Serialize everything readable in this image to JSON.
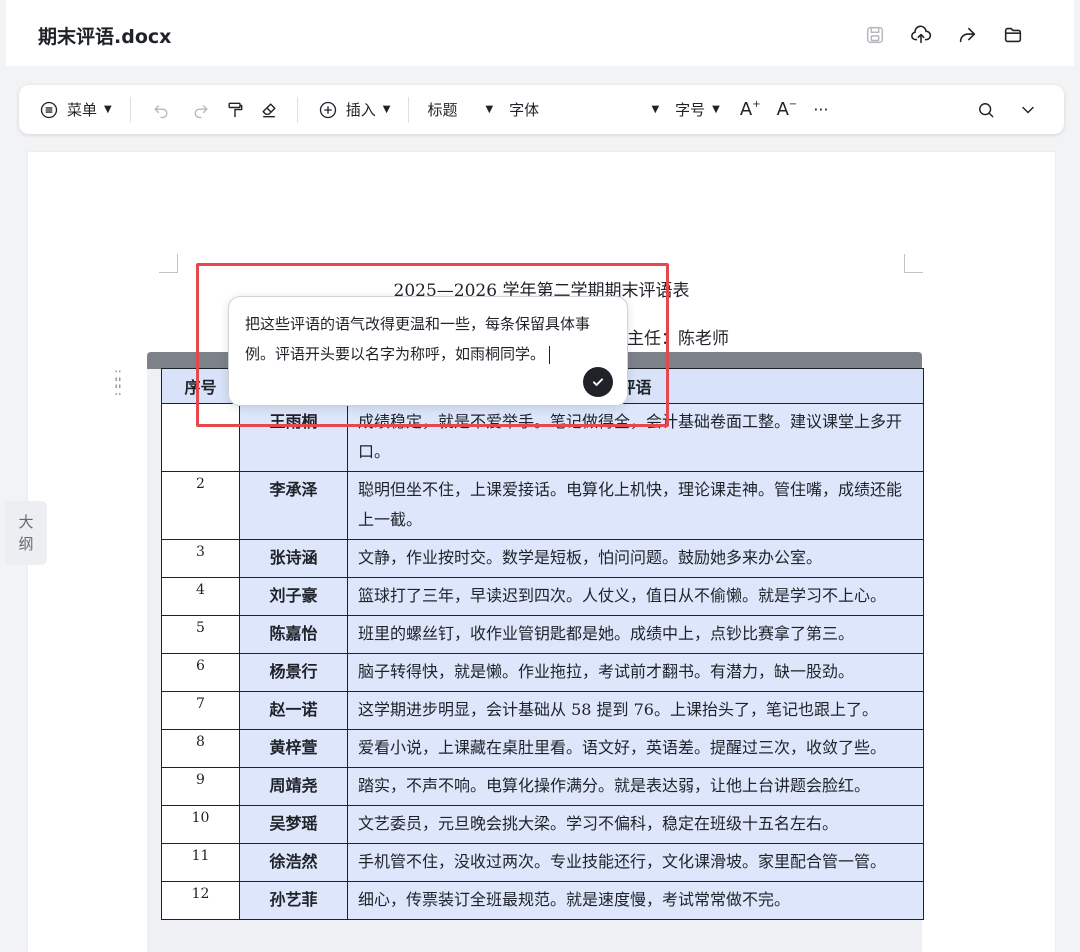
{
  "header": {
    "doc_title": "期末评语.docx",
    "icons": [
      "save-icon",
      "cloud-upload-icon",
      "share-icon",
      "folder-icon"
    ]
  },
  "toolbar": {
    "menu_label": "菜单",
    "insert_label": "插入",
    "heading_label": "标题",
    "font_label": "字体",
    "font_size_label": "字号",
    "increase_font": "A",
    "decrease_font": "A",
    "more": "···"
  },
  "sidebar": {
    "outline_label_1": "大",
    "outline_label_2": "纲"
  },
  "document": {
    "title": "2025—2026 学年第二学期期末评语表",
    "teacher_line": "主任：陈老师",
    "table": {
      "headers": [
        "序号",
        "",
        "评语"
      ],
      "rows": [
        {
          "no": "",
          "name": "王雨桐",
          "comment": "成绩稳定，就是不爱举手。笔记做得全，会计基础卷面工整。建议课堂上多开口。"
        },
        {
          "no": "2",
          "name": "李承泽",
          "comment": "聪明但坐不住，上课爱接话。电算化上机快，理论课走神。管住嘴，成绩还能上一截。"
        },
        {
          "no": "3",
          "name": "张诗涵",
          "comment": "文静，作业按时交。数学是短板，怕问问题。鼓励她多来办公室。"
        },
        {
          "no": "4",
          "name": "刘子豪",
          "comment": "篮球打了三年，早读迟到四次。人仗义，值日从不偷懒。就是学习不上心。"
        },
        {
          "no": "5",
          "name": "陈嘉怡",
          "comment": "班里的螺丝钉，收作业管钥匙都是她。成绩中上，点钞比赛拿了第三。"
        },
        {
          "no": "6",
          "name": "杨景行",
          "comment": "脑子转得快，就是懒。作业拖拉，考试前才翻书。有潜力，缺一股劲。"
        },
        {
          "no": "7",
          "name": "赵一诺",
          "comment": "这学期进步明显，会计基础从 58 提到 76。上课抬头了，笔记也跟上了。"
        },
        {
          "no": "8",
          "name": "黄梓萱",
          "comment": "爱看小说，上课藏在桌肚里看。语文好，英语差。提醒过三次，收敛了些。"
        },
        {
          "no": "9",
          "name": "周靖尧",
          "comment": "踏实，不声不响。电算化操作满分。就是表达弱，让他上台讲题会脸红。"
        },
        {
          "no": "10",
          "name": "吴梦瑶",
          "comment": "文艺委员，元旦晚会挑大梁。学习不偏科，稳定在班级十五名左右。"
        },
        {
          "no": "11",
          "name": "徐浩然",
          "comment": "手机管不住，没收过两次。专业技能还行，文化课滑坡。家里配合管一管。"
        },
        {
          "no": "12",
          "name": "孙艺菲",
          "comment": "细心，传票装订全班最规范。就是速度慢，考试常常做不完。"
        }
      ]
    }
  },
  "prompt": {
    "text": "把这些评语的语气改得更温和一些，每条保留具体事例。评语开头要以名字为称呼，如雨桐同学。"
  },
  "colors": {
    "highlight_border": "#e5484d",
    "table_fill": "#dde6fb",
    "header_fill": "#d8e2f8"
  }
}
